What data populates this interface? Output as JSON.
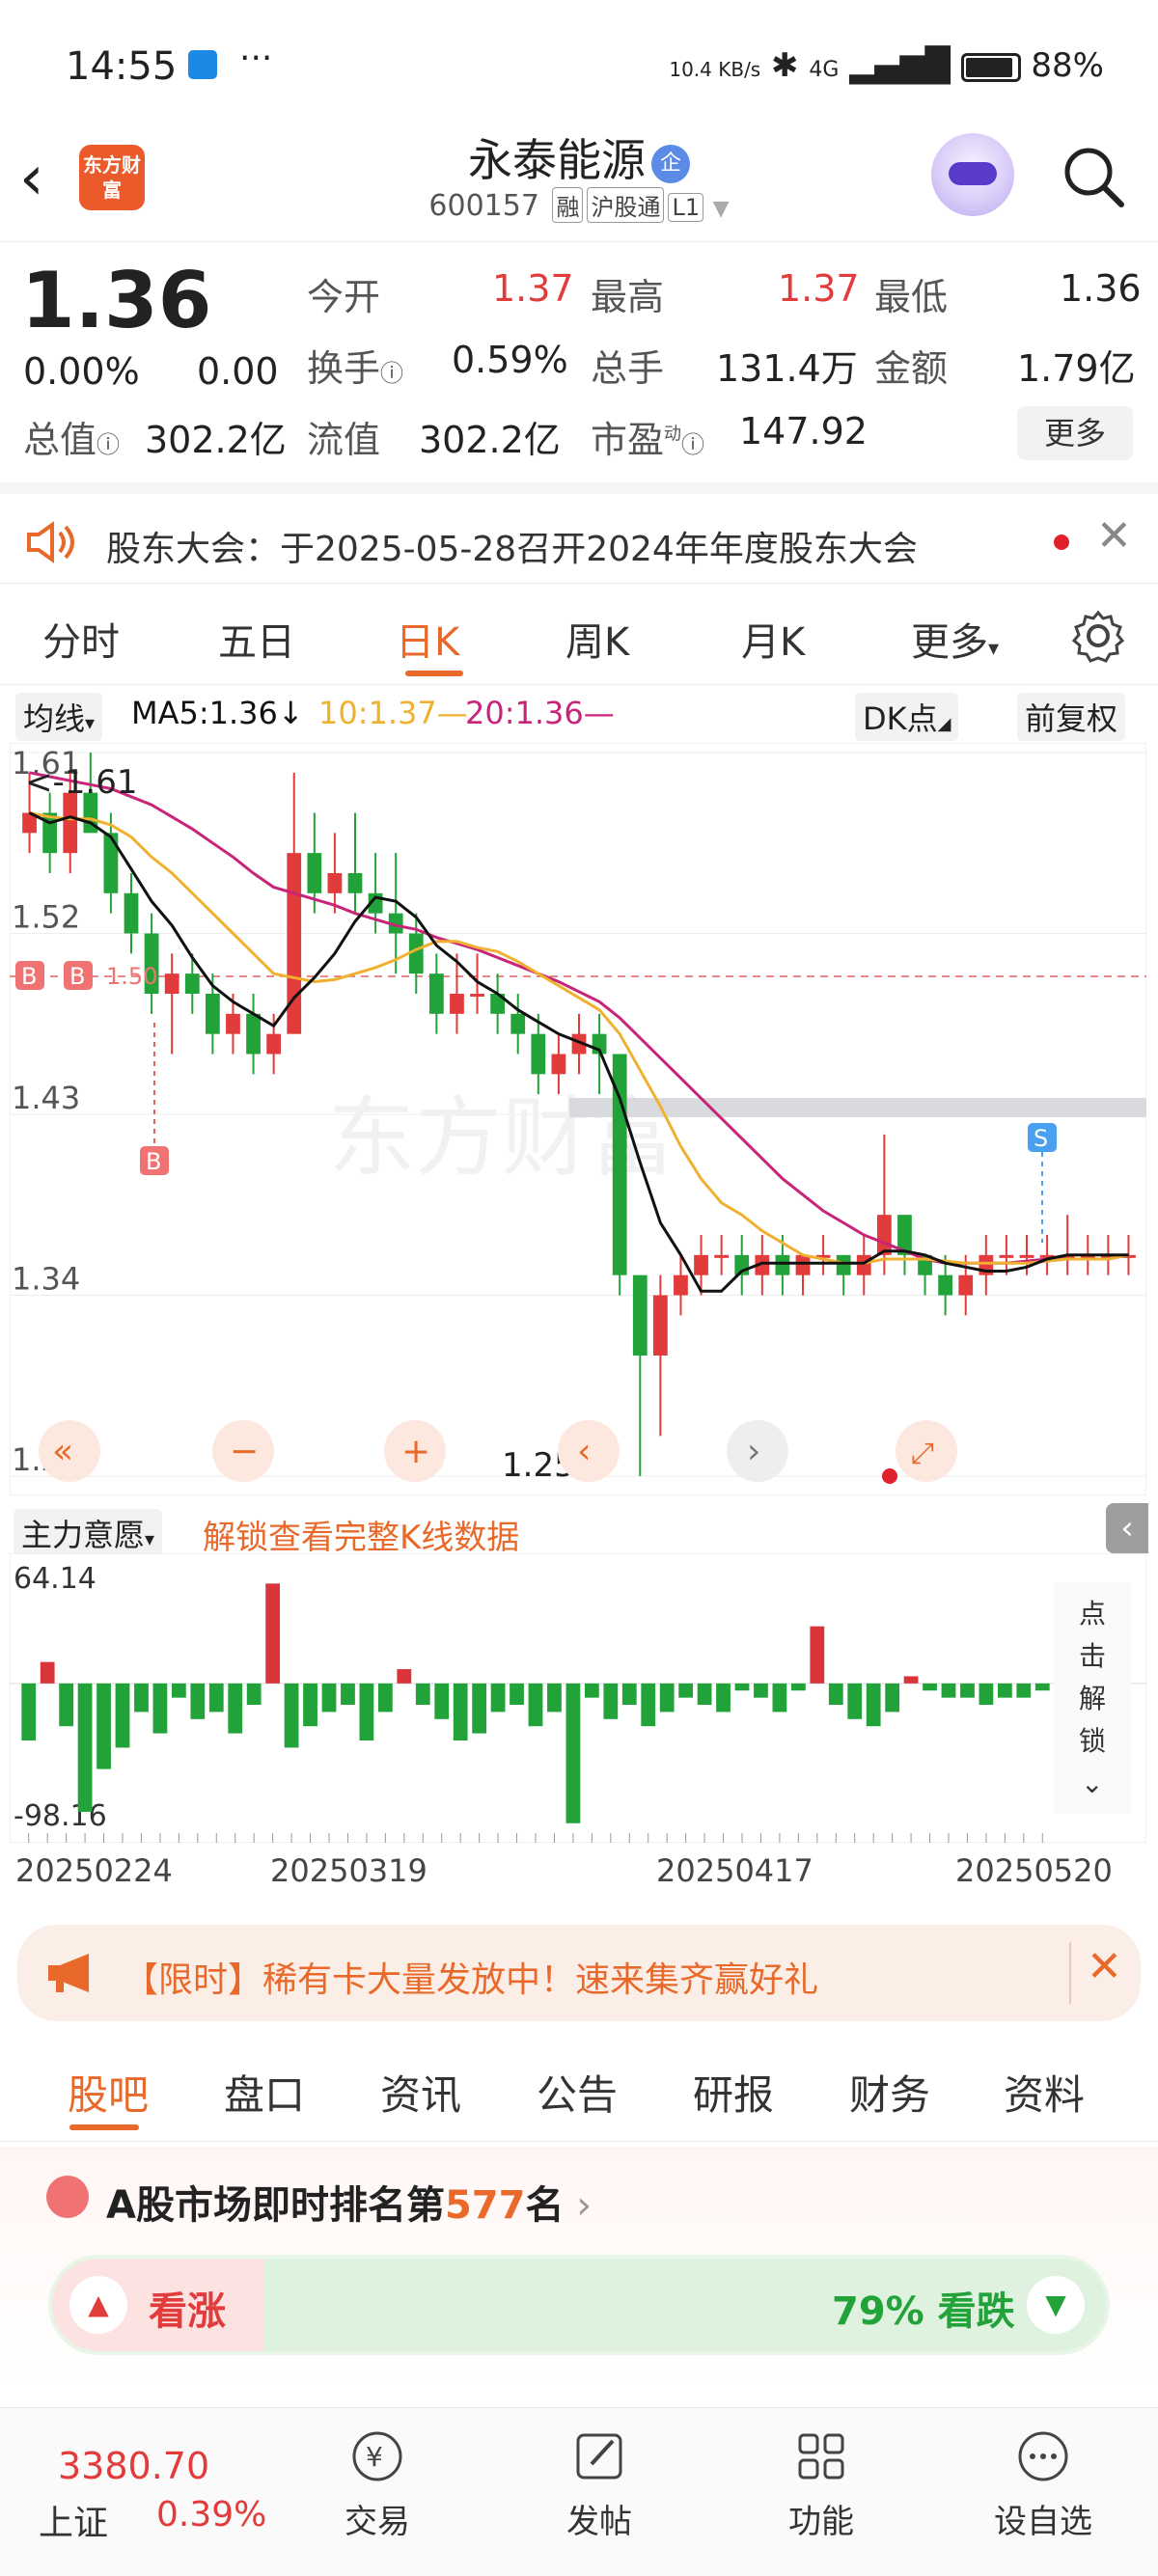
{
  "status_bar": {
    "time": "14:55",
    "net_speed": "10.4 KB/s",
    "signal": "4G",
    "battery": "88%"
  },
  "header": {
    "logo_text": "东方财富",
    "stock_name": "永泰能源",
    "badge": "企",
    "code": "600157",
    "tags": [
      "融",
      "沪股通",
      "L1"
    ]
  },
  "quote": {
    "price": "1.36",
    "change_pct": "0.00%",
    "change": "0.00",
    "open_label": "今开",
    "open": "1.37",
    "high_label": "最高",
    "high": "1.37",
    "low_label": "最低",
    "low": "1.36",
    "turnover_label": "换手",
    "turnover": "0.59%",
    "volume_label": "总手",
    "volume": "131.4万",
    "amount_label": "金额",
    "amount": "1.79亿",
    "mktcap_label": "总值",
    "mktcap": "302.2亿",
    "float_label": "流值",
    "float_cap": "302.2亿",
    "pe_label": "市盈",
    "pe_sup": "动",
    "pe": "147.92",
    "more": "更多"
  },
  "notice": {
    "text": "股东大会：于2025-05-28召开2024年年度股东大会"
  },
  "ktabs": [
    "分时",
    "五日",
    "日K",
    "周K",
    "月K",
    "更多"
  ],
  "ma": {
    "selector": "均线",
    "ma5": "MA5:1.36",
    "ma10": "10:1.37",
    "ma20": "20:1.36",
    "dk": "DK点",
    "adjust": "前复权",
    "colors": {
      "ma5": "#111111",
      "ma10": "#f0b030",
      "ma20": "#c8257a"
    }
  },
  "chart": {
    "y_ticks": [
      "1.61",
      "1.52",
      "1.43",
      "1.34",
      "1.25"
    ],
    "max_label": "<-1.61",
    "min_label": "1.25->",
    "ref_label": "1.50",
    "markers": [
      "B",
      "B",
      "B",
      "S"
    ]
  },
  "indicator": {
    "selector": "主力意愿",
    "unlock_text": "解锁查看完整K线数据",
    "top": "64.14",
    "bottom": "-98.16",
    "side_text": "点击解锁"
  },
  "dates": [
    "20250224",
    "20250319",
    "20250417",
    "20250520"
  ],
  "promo": {
    "text": "【限时】稀有卡大量发放中！速来集齐赢好礼"
  },
  "btabs": [
    "股吧",
    "盘口",
    "资讯",
    "公告",
    "研报",
    "财务",
    "资料"
  ],
  "rank": {
    "prefix": "A股市场即时排名第",
    "number": "577",
    "suffix": "名",
    "up_label": "看涨",
    "down_label": "79% 看跌"
  },
  "bottom_nav": {
    "index_value": "3380.70",
    "index_name": "上证",
    "index_pct": "0.39%",
    "items": [
      "交易",
      "发帖",
      "功能",
      "设自选"
    ]
  },
  "chart_data": {
    "type": "candlestick",
    "y_range": [
      1.25,
      1.61
    ],
    "ohlc": [
      [
        1.57,
        1.6,
        1.56,
        1.58
      ],
      [
        1.58,
        1.59,
        1.55,
        1.56
      ],
      [
        1.56,
        1.6,
        1.55,
        1.59
      ],
      [
        1.59,
        1.61,
        1.57,
        1.57
      ],
      [
        1.57,
        1.58,
        1.53,
        1.54
      ],
      [
        1.54,
        1.55,
        1.51,
        1.52
      ],
      [
        1.52,
        1.53,
        1.48,
        1.49
      ],
      [
        1.49,
        1.51,
        1.46,
        1.5
      ],
      [
        1.5,
        1.51,
        1.48,
        1.49
      ],
      [
        1.49,
        1.5,
        1.46,
        1.47
      ],
      [
        1.47,
        1.49,
        1.46,
        1.48
      ],
      [
        1.48,
        1.49,
        1.45,
        1.46
      ],
      [
        1.46,
        1.48,
        1.45,
        1.47
      ],
      [
        1.47,
        1.6,
        1.47,
        1.56
      ],
      [
        1.56,
        1.58,
        1.53,
        1.54
      ],
      [
        1.54,
        1.57,
        1.53,
        1.55
      ],
      [
        1.55,
        1.58,
        1.53,
        1.54
      ],
      [
        1.54,
        1.56,
        1.52,
        1.53
      ],
      [
        1.53,
        1.56,
        1.5,
        1.52
      ],
      [
        1.52,
        1.53,
        1.49,
        1.5
      ],
      [
        1.5,
        1.51,
        1.47,
        1.48
      ],
      [
        1.48,
        1.51,
        1.47,
        1.49
      ],
      [
        1.49,
        1.51,
        1.48,
        1.49
      ],
      [
        1.49,
        1.5,
        1.47,
        1.48
      ],
      [
        1.48,
        1.49,
        1.46,
        1.47
      ],
      [
        1.47,
        1.48,
        1.44,
        1.45
      ],
      [
        1.45,
        1.47,
        1.44,
        1.46
      ],
      [
        1.46,
        1.48,
        1.45,
        1.47
      ],
      [
        1.47,
        1.48,
        1.44,
        1.46
      ],
      [
        1.46,
        1.46,
        1.34,
        1.35
      ],
      [
        1.35,
        1.35,
        1.25,
        1.31
      ],
      [
        1.31,
        1.35,
        1.27,
        1.34
      ],
      [
        1.34,
        1.36,
        1.33,
        1.35
      ],
      [
        1.35,
        1.37,
        1.34,
        1.36
      ],
      [
        1.36,
        1.37,
        1.35,
        1.36
      ],
      [
        1.36,
        1.37,
        1.34,
        1.35
      ],
      [
        1.35,
        1.37,
        1.34,
        1.36
      ],
      [
        1.36,
        1.37,
        1.34,
        1.35
      ],
      [
        1.35,
        1.36,
        1.34,
        1.36
      ],
      [
        1.36,
        1.37,
        1.35,
        1.36
      ],
      [
        1.36,
        1.36,
        1.34,
        1.35
      ],
      [
        1.35,
        1.37,
        1.34,
        1.36
      ],
      [
        1.36,
        1.42,
        1.35,
        1.38
      ],
      [
        1.38,
        1.38,
        1.35,
        1.36
      ],
      [
        1.36,
        1.36,
        1.34,
        1.35
      ],
      [
        1.35,
        1.36,
        1.33,
        1.34
      ],
      [
        1.34,
        1.36,
        1.33,
        1.35
      ],
      [
        1.35,
        1.37,
        1.34,
        1.36
      ],
      [
        1.36,
        1.37,
        1.35,
        1.36
      ],
      [
        1.36,
        1.37,
        1.35,
        1.36
      ],
      [
        1.36,
        1.37,
        1.35,
        1.36
      ],
      [
        1.36,
        1.38,
        1.35,
        1.36
      ],
      [
        1.36,
        1.37,
        1.35,
        1.36
      ],
      [
        1.36,
        1.37,
        1.35,
        1.36
      ],
      [
        1.36,
        1.37,
        1.35,
        1.36
      ]
    ],
    "vol": [
      -40,
      15,
      -30,
      -90,
      -60,
      -45,
      -20,
      -35,
      -10,
      -25,
      -20,
      -35,
      -15,
      70,
      -45,
      -30,
      -20,
      -15,
      -40,
      -20,
      10,
      -15,
      -25,
      -40,
      -35,
      -20,
      -15,
      -30,
      -20,
      -98,
      -10,
      -25,
      -15,
      -30,
      -20,
      -10,
      -15,
      -20,
      -5,
      -10,
      -20,
      -5,
      40,
      -15,
      -25,
      -30,
      -20,
      5,
      -5,
      -10,
      -10,
      -15,
      -10,
      -10,
      -5
    ],
    "ma5": [
      1.58,
      1.575,
      1.578,
      1.575,
      1.568,
      1.552,
      1.536,
      1.524,
      1.508,
      1.494,
      1.486,
      1.48,
      1.474,
      1.488,
      1.498,
      1.51,
      1.526,
      1.538,
      1.536,
      1.528,
      1.514,
      1.506,
      1.496,
      1.49,
      1.482,
      1.476,
      1.47,
      1.466,
      1.462,
      1.438,
      1.406,
      1.376,
      1.36,
      1.342,
      1.342,
      1.352,
      1.356,
      1.356,
      1.356,
      1.356,
      1.356,
      1.356,
      1.362,
      1.362,
      1.36,
      1.356,
      1.354,
      1.352,
      1.352,
      1.354,
      1.358,
      1.36,
      1.36,
      1.36,
      1.36
    ],
    "ma10": [
      1.58,
      1.578,
      1.577,
      1.577,
      1.574,
      1.568,
      1.558,
      1.55,
      1.54,
      1.53,
      1.52,
      1.51,
      1.5,
      1.498,
      1.496,
      1.497,
      1.5,
      1.503,
      1.507,
      1.512,
      1.516,
      1.516,
      1.513,
      1.511,
      1.506,
      1.5,
      1.494,
      1.488,
      1.482,
      1.47,
      1.452,
      1.434,
      1.414,
      1.398,
      1.386,
      1.38,
      1.372,
      1.366,
      1.36,
      1.358,
      1.356,
      1.356,
      1.358,
      1.358,
      1.358,
      1.357,
      1.356,
      1.356,
      1.356,
      1.356,
      1.357,
      1.358,
      1.358,
      1.358,
      1.36
    ],
    "ma20": [
      1.6,
      1.598,
      1.596,
      1.594,
      1.592,
      1.588,
      1.584,
      1.578,
      1.572,
      1.565,
      1.558,
      1.55,
      1.543,
      1.54,
      1.537,
      1.534,
      1.53,
      1.527,
      1.524,
      1.522,
      1.518,
      1.515,
      1.512,
      1.508,
      1.504,
      1.5,
      1.496,
      1.491,
      1.486,
      1.478,
      1.468,
      1.458,
      1.448,
      1.438,
      1.428,
      1.418,
      1.408,
      1.398,
      1.39,
      1.382,
      1.376,
      1.37,
      1.366,
      1.362,
      1.358,
      1.356,
      1.356,
      1.356,
      1.356,
      1.357,
      1.358,
      1.358,
      1.358,
      1.358,
      1.36
    ]
  }
}
